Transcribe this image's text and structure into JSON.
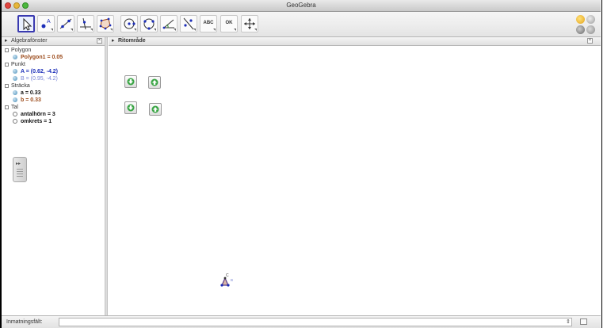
{
  "window": {
    "title": "GeoGebra"
  },
  "toolbar": {
    "tools": [
      {
        "name": "move-tool"
      },
      {
        "name": "point-tool",
        "label": "A"
      },
      {
        "name": "line-tool"
      },
      {
        "name": "perpendicular-tool"
      },
      {
        "name": "polygon-tool"
      },
      {
        "name": "circle-tool"
      },
      {
        "name": "circle-through-points-tool"
      },
      {
        "name": "angle-tool"
      },
      {
        "name": "reflect-tool"
      },
      {
        "name": "text-tool",
        "label": "ABC"
      },
      {
        "name": "button-tool",
        "label": "OK"
      },
      {
        "name": "move-graphics-tool"
      }
    ]
  },
  "algebra_view": {
    "header": "Algebrafönster",
    "categories": [
      {
        "label": "Polygon",
        "items": [
          {
            "text": "Polygon1 = 0.05",
            "color": "#9b4a1a"
          }
        ]
      },
      {
        "label": "Punkt",
        "items": [
          {
            "text": "A = (0.62, -4.2)",
            "color": "#1b2db8"
          },
          {
            "text": "B = (0.95, -4.2)",
            "color": "#7a86d6"
          }
        ]
      },
      {
        "label": "Sträcka",
        "items": [
          {
            "text": "a = 0.33",
            "color": "#111111"
          },
          {
            "text": "b = 0.33",
            "color": "#9b4a1a"
          }
        ]
      },
      {
        "label": "Tal",
        "items": [
          {
            "text": "antalhörn = 3",
            "color": "#111111"
          },
          {
            "text": "omkrets = 1",
            "color": "#111111"
          }
        ]
      }
    ]
  },
  "graphics_view": {
    "header": "Ritområde",
    "point_labels": {
      "top": "C",
      "right": "B"
    }
  },
  "input_bar": {
    "label": "Inmatningsfält:",
    "value": ""
  }
}
